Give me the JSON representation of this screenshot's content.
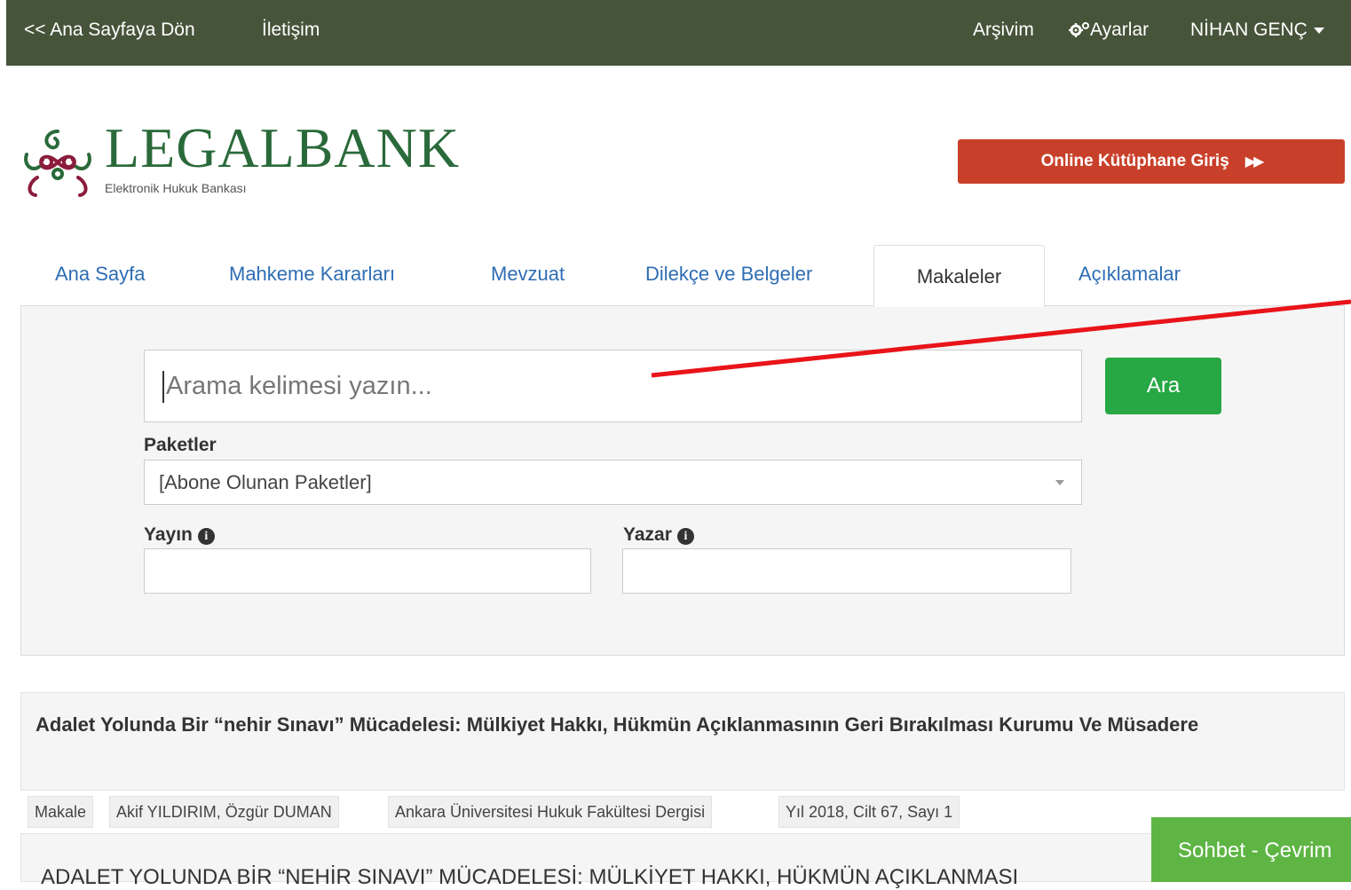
{
  "topbar": {
    "back_link": "<< Ana Sayfaya Dön",
    "contact": "İletişim",
    "archive": "Arşivim",
    "settings": "Ayarlar",
    "user": "NİHAN GENÇ"
  },
  "brand": {
    "name": "LEGALBANK",
    "subtitle": "Elektronik Hukuk Bankası",
    "online_button": "Online Kütüphane Giriş"
  },
  "tabs": [
    {
      "label": "Ana Sayfa",
      "active": false
    },
    {
      "label": "Mahkeme Kararları",
      "active": false
    },
    {
      "label": "Mevzuat",
      "active": false
    },
    {
      "label": "Dilekçe ve Belgeler",
      "active": false
    },
    {
      "label": "Makaleler",
      "active": true
    },
    {
      "label": "Açıklamalar",
      "active": false
    }
  ],
  "search": {
    "placeholder": "Arama kelimesi yazın...",
    "button": "Ara",
    "packages_label": "Paketler",
    "packages_value": "[Abone Olunan Paketler]",
    "publication_label": "Yayın",
    "author_label": "Yazar"
  },
  "result": {
    "title": "Adalet Yolunda Bir “nehir Sınavı” Mücadelesi: Mülkiyet Hakkı, Hükmün Açıklanmasının Geri Bırakılması Kurumu Ve Müsadere",
    "type": "Makale",
    "authors": "Akif YILDIRIM, Özgür DUMAN",
    "journal": "Ankara Üniversitesi Hukuk Fakültesi Dergisi",
    "issue": "Yıl 2018, Cilt 67, Sayı 1",
    "excerpt": "ADALET YOLUNDA BİR “NEHİR SINAVI” MÜCADELESİ: MÜLKİYET HAKKI, HÜKMÜN AÇIKLANMASI"
  },
  "chat": {
    "label": "Sohbet - Çevrim"
  },
  "colors": {
    "topbar": "#46543a",
    "brand_green": "#2a6a3a",
    "online_button": "#c9402a",
    "search_button": "#28a745",
    "link": "#2e6db4",
    "annotation": "#e8141a",
    "chat": "#5eb544"
  }
}
